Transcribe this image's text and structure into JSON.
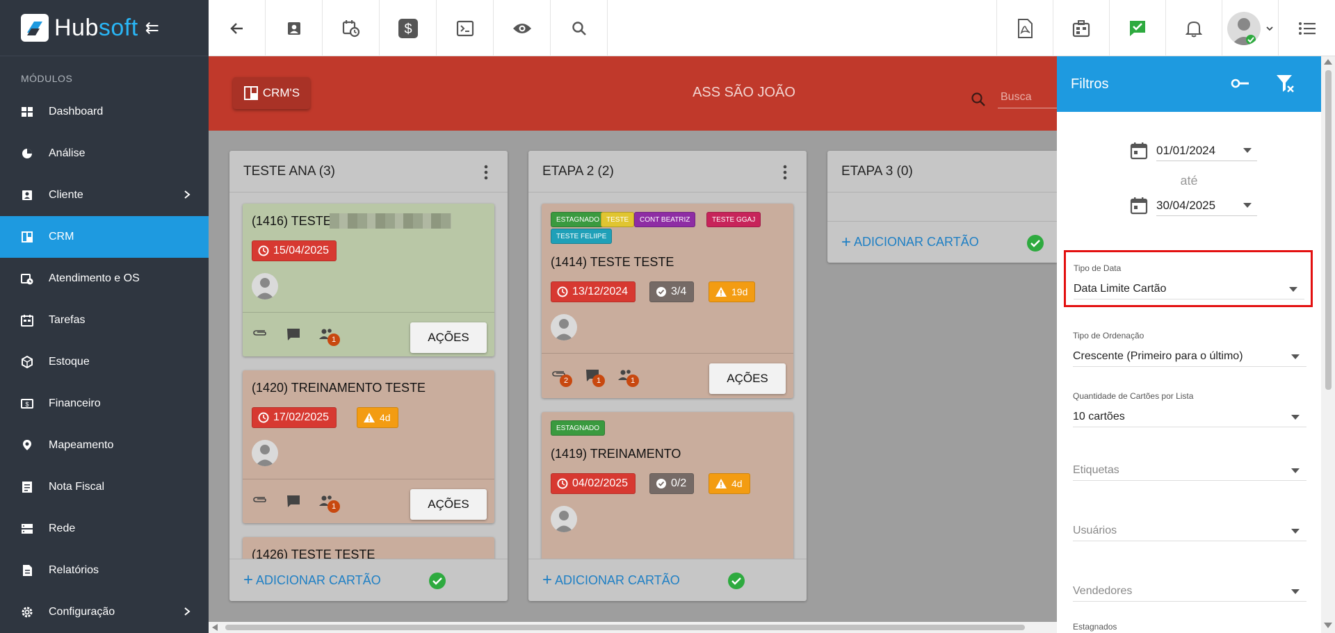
{
  "app": {
    "name_part1": "Hub",
    "name_part2": "soft",
    "brand_color": "#1e9ae0"
  },
  "sidebar": {
    "section_title": "MÓDULOS",
    "items": [
      {
        "label": "Dashboard",
        "icon": "dashboard-icon"
      },
      {
        "label": "Análise",
        "icon": "pie-chart-icon"
      },
      {
        "label": "Cliente",
        "icon": "contact-card-icon",
        "has_submenu": true
      },
      {
        "label": "CRM",
        "icon": "kanban-icon",
        "active": true
      },
      {
        "label": "Atendimento e OS",
        "icon": "calendar-clock-icon"
      },
      {
        "label": "Tarefas",
        "icon": "task-calendar-icon"
      },
      {
        "label": "Estoque",
        "icon": "package-icon"
      },
      {
        "label": "Financeiro",
        "icon": "money-icon"
      },
      {
        "label": "Mapeamento",
        "icon": "map-pin-icon"
      },
      {
        "label": "Nota Fiscal",
        "icon": "invoice-icon"
      },
      {
        "label": "Rede",
        "icon": "server-icon"
      },
      {
        "label": "Relatórios",
        "icon": "report-icon"
      },
      {
        "label": "Configuração",
        "icon": "gear-icon",
        "has_submenu": true
      }
    ]
  },
  "topbar": {
    "left_icons": [
      "back-arrow-icon",
      "contact-card-icon",
      "calendar-clock-icon",
      "dollar-icon",
      "terminal-icon",
      "eye-icon",
      "search-icon"
    ],
    "right_icons": [
      "pdf-icon",
      "building-icon",
      "check-chat-icon",
      "bell-icon",
      "user-avatar",
      "list-menu-icon"
    ]
  },
  "board": {
    "crms_button": "CRM'S",
    "title": "ASS SÃO JOÃO",
    "search_placeholder": "Busca",
    "header_color": "#c0392b"
  },
  "lists": [
    {
      "title": "TESTE ANA (3)",
      "add_label": "ADICIONAR CARTÃO",
      "cards": [
        {
          "title": "(1416) TESTE",
          "date": "15/04/2025",
          "color": "#b9c7a6",
          "actions": "AÇÕES",
          "assignee_count": "1"
        },
        {
          "title": "(1420) TREINAMENTO TESTE",
          "date": "17/02/2025",
          "warning": "4d",
          "color": "#c9ad9d",
          "actions": "AÇÕES",
          "assignee_count": "1"
        },
        {
          "title": "(1426) TESTE TESTE",
          "color": "#c9ad9d"
        }
      ]
    },
    {
      "title": "ETAPA 2 (2)",
      "add_label": "ADICIONAR CARTÃO",
      "cards": [
        {
          "tags": [
            {
              "label": "ESTAGNADO",
              "color": "#3a9a3f"
            },
            {
              "label": "TESTE",
              "color": "#e0c531"
            },
            {
              "label": "CONT BEATRIZ",
              "color": "#8e2da4"
            },
            {
              "label": "TESTE GGAJ",
              "color": "#c7245a"
            },
            {
              "label": "TESTE FELIIPE",
              "color": "#1fa0b8"
            }
          ],
          "title": "(1414) TESTE TESTE",
          "date": "13/12/2024",
          "checklist": "3/4",
          "warning": "19d",
          "color": "#c9ad9d",
          "actions": "AÇÕES",
          "attachments_count": "2",
          "comments_count": "1",
          "assignee_count": "1"
        },
        {
          "tags": [
            {
              "label": "ESTAGNADO",
              "color": "#3a9a3f"
            }
          ],
          "title": "(1419) TREINAMENTO",
          "date": "04/02/2025",
          "checklist": "0/2",
          "warning": "4d",
          "color": "#c9ad9d"
        }
      ]
    },
    {
      "title": "ETAPA 3 (0)",
      "add_label": "ADICIONAR CARTÃO",
      "cards": []
    }
  ],
  "filters": {
    "title": "Filtros",
    "date_from": "01/01/2024",
    "date_separator": "até",
    "date_to": "30/04/2025",
    "date_type": {
      "label": "Tipo de Data",
      "value": "Data Limite Cartão"
    },
    "order_type": {
      "label": "Tipo de Ordenação",
      "value": "Crescente (Primeiro para o último)"
    },
    "cards_per_list": {
      "label": "Quantidade de Cartões por Lista",
      "value": "10 cartões"
    },
    "tags_placeholder": "Etiquetas",
    "users_placeholder": "Usuários",
    "sellers_placeholder": "Vendedores",
    "stagnant_label": "Estagnados"
  }
}
